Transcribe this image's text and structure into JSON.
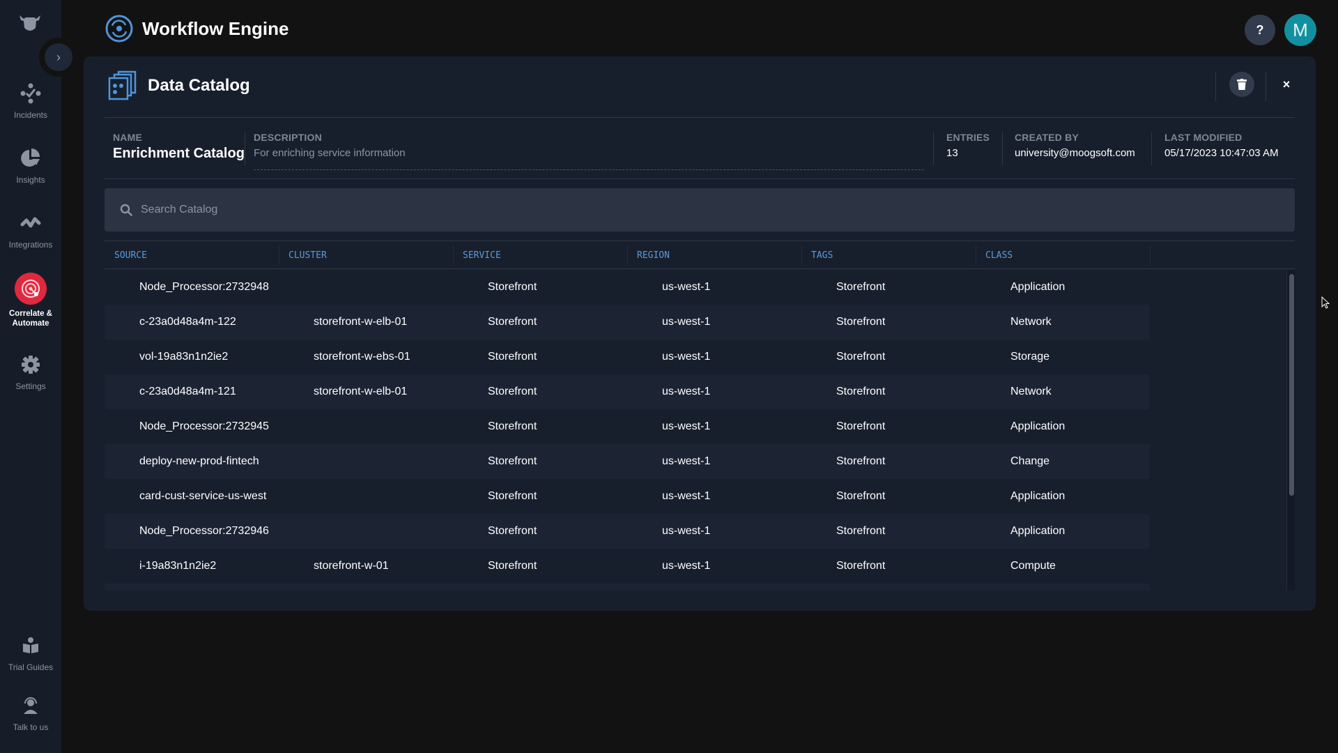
{
  "app": {
    "title": "Workflow Engine",
    "help_label": "?",
    "avatar_initial": "M"
  },
  "sidebar": {
    "items": [
      {
        "label": "Incidents",
        "icon": "incidents-icon"
      },
      {
        "label": "Insights",
        "icon": "pie-chart-icon"
      },
      {
        "label": "Integrations",
        "icon": "integrations-icon"
      },
      {
        "label": "Correlate & Automate",
        "icon": "radar-icon",
        "active": true
      },
      {
        "label": "Settings",
        "icon": "gear-icon"
      },
      {
        "label": "Trial Guides",
        "icon": "book-reader-icon"
      },
      {
        "label": "Talk to us",
        "icon": "headset-icon"
      }
    ],
    "expand_icon": "›"
  },
  "panel": {
    "title": "Data Catalog",
    "close_label": "×",
    "meta": {
      "name_label": "NAME",
      "name_value": "Enrichment Catalog",
      "description_label": "DESCRIPTION",
      "description_value": "For enriching service information",
      "entries_label": "ENTRIES",
      "entries_value": "13",
      "created_by_label": "CREATED BY",
      "created_by_value": "university@moogsoft.com",
      "last_modified_label": "LAST MODIFIED",
      "last_modified_value": "05/17/2023 10:47:03 AM"
    },
    "search": {
      "placeholder": "Search Catalog",
      "value": ""
    },
    "table": {
      "columns": [
        "SOURCE",
        "CLUSTER",
        "SERVICE",
        "REGION",
        "TAGS",
        "CLASS"
      ],
      "rows": [
        [
          "Node_Processor:2732948",
          "",
          "Storefront",
          "us-west-1",
          "Storefront",
          "Application"
        ],
        [
          "c-23a0d48a4m-122",
          "storefront-w-elb-01",
          "Storefront",
          "us-west-1",
          "Storefront",
          "Network"
        ],
        [
          "vol-19a83n1n2ie2",
          "storefront-w-ebs-01",
          "Storefront",
          "us-west-1",
          "Storefront",
          "Storage"
        ],
        [
          "c-23a0d48a4m-121",
          "storefront-w-elb-01",
          "Storefront",
          "us-west-1",
          "Storefront",
          "Network"
        ],
        [
          "Node_Processor:2732945",
          "",
          "Storefront",
          "us-west-1",
          "Storefront",
          "Application"
        ],
        [
          "deploy-new-prod-fintech",
          "",
          "Storefront",
          "us-west-1",
          "Storefront",
          "Change"
        ],
        [
          "card-cust-service-us-west",
          "",
          "Storefront",
          "us-west-1",
          "Storefront",
          "Application"
        ],
        [
          "Node_Processor:2732946",
          "",
          "Storefront",
          "us-west-1",
          "Storefront",
          "Application"
        ],
        [
          "i-19a83n1n2ie2",
          "storefront-w-01",
          "Storefront",
          "us-west-1",
          "Storefront",
          "Compute"
        ]
      ]
    }
  },
  "colors": {
    "accent_blue": "#5b9bdc",
    "active_nav": "#e0283f",
    "avatar": "#13909f"
  }
}
